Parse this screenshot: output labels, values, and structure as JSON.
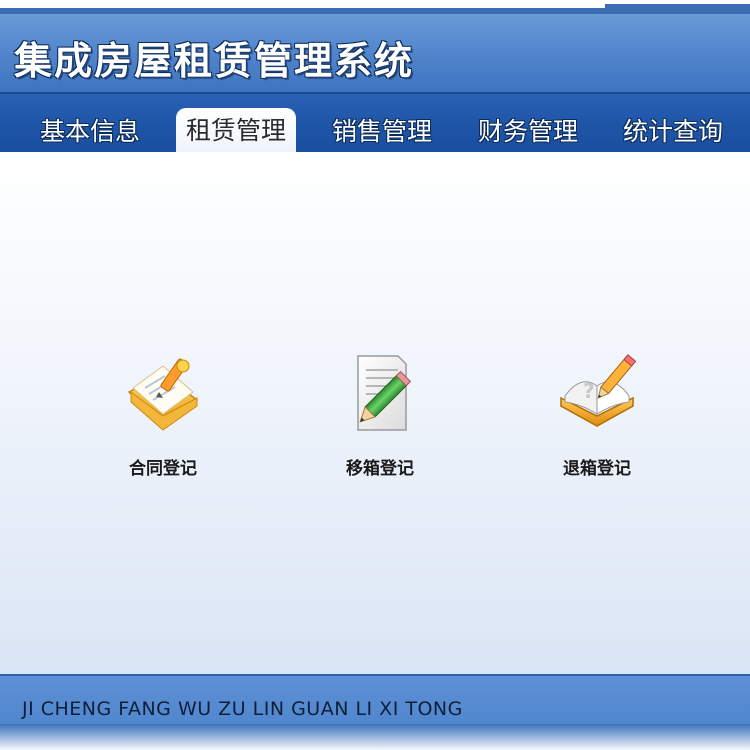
{
  "app": {
    "title": "集成房屋租赁管理系统"
  },
  "nav": {
    "tabs": [
      {
        "label": "基本信息",
        "active": false
      },
      {
        "label": "租赁管理",
        "active": true
      },
      {
        "label": "销售管理",
        "active": false
      },
      {
        "label": "财务管理",
        "active": false
      },
      {
        "label": "统计查询",
        "active": false
      }
    ]
  },
  "functions": [
    {
      "label": "合同登记",
      "icon": "contract-folder-icon"
    },
    {
      "label": "移箱登记",
      "icon": "document-pencil-icon"
    },
    {
      "label": "退箱登记",
      "icon": "book-pencil-icon"
    }
  ],
  "footer": {
    "slogan": "JI CHENG FANG WU ZU LIN GUAN LI XI TONG"
  },
  "colors": {
    "header_blue": "#4f84cc",
    "nav_blue": "#1f56a8",
    "footer_blue": "#4a82cc",
    "active_tab": "#ffffff"
  }
}
